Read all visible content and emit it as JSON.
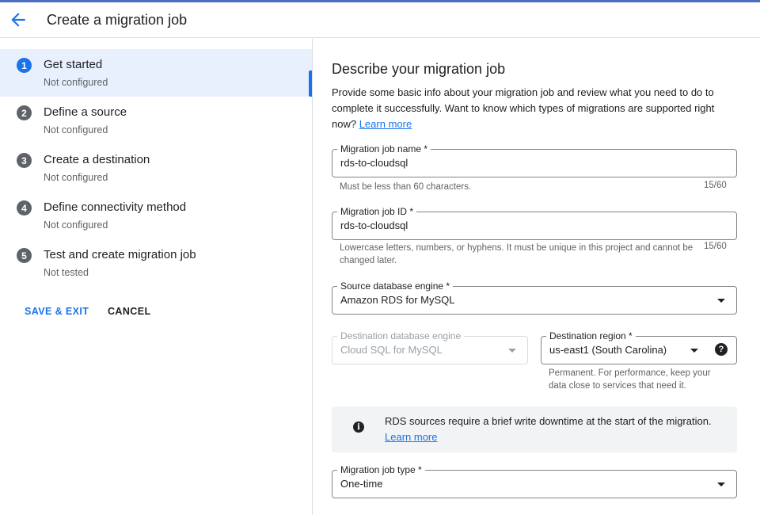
{
  "header": {
    "title": "Create a migration job"
  },
  "steps": [
    {
      "number": "1",
      "title": "Get started",
      "status": "Not configured",
      "active": true
    },
    {
      "number": "2",
      "title": "Define a source",
      "status": "Not configured",
      "active": false
    },
    {
      "number": "3",
      "title": "Create a destination",
      "status": "Not configured",
      "active": false
    },
    {
      "number": "4",
      "title": "Define connectivity method",
      "status": "Not configured",
      "active": false
    },
    {
      "number": "5",
      "title": "Test and create migration job",
      "status": "Not tested",
      "active": false
    }
  ],
  "actions": {
    "save_exit": "SAVE & EXIT",
    "cancel": "CANCEL"
  },
  "main": {
    "section_title": "Describe your migration job",
    "description": "Provide some basic info about your migration job and review what you need to do to complete it successfully. Want to know which types of migrations are supported right now?",
    "learn_more": "Learn more",
    "job_name": {
      "label": "Migration job name *",
      "value": "rds-to-cloudsql",
      "hint": "Must be less than 60 characters.",
      "counter": "15/60"
    },
    "job_id": {
      "label": "Migration job ID *",
      "value": "rds-to-cloudsql",
      "hint": "Lowercase letters, numbers, or hyphens. It must be unique in this project and cannot be changed later.",
      "counter": "15/60"
    },
    "source_engine": {
      "label": "Source database engine *",
      "value": "Amazon RDS for MySQL"
    },
    "dest_engine": {
      "label": "Destination database engine",
      "value": "Cloud SQL for MySQL"
    },
    "dest_region": {
      "label": "Destination region *",
      "value": "us-east1 (South Carolina)",
      "hint": "Permanent. For performance, keep your data close to services that need it."
    },
    "info": {
      "text": "RDS sources require a brief write downtime at the start of the migration.",
      "link": "Learn more"
    },
    "job_type": {
      "label": "Migration job type *",
      "value": "One-time"
    }
  },
  "colors": {
    "accent": "#1a73e8",
    "active_bg": "#e8f0fe",
    "info_bg": "#f1f3f4"
  }
}
